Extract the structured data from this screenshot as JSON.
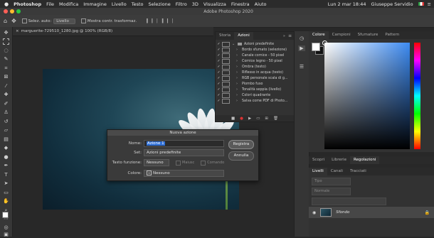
{
  "menubar": {
    "apple": "",
    "items": [
      "Photoshop",
      "File",
      "Modifica",
      "Immagine",
      "Livello",
      "Testo",
      "Selezione",
      "Filtro",
      "3D",
      "Visualizza",
      "Finestra",
      "Aiuto"
    ],
    "clock": "Lun 2 mar 18:44",
    "user": "Giuseppe Servidio"
  },
  "window": {
    "title": "Adobe Photoshop 2020"
  },
  "options": {
    "auto_select_label": "Selez. auto:",
    "auto_select_value": "Livello",
    "transform_label": "Mostra contr. trasformaz."
  },
  "document": {
    "tab": "marguerite-729510_1280.jpg @ 100% (RGB/8)"
  },
  "actions_panel": {
    "tabs": [
      "Storia",
      "Azioni"
    ],
    "active_tab": "Azioni",
    "set_name": "Azioni predefinite",
    "items": [
      "Bordo sfumato (selezione)",
      "Canale cornice - 50 pixel",
      "Cornice legno - 50 pixel",
      "Ombra (testo)",
      "Riflesso in acqua (testo)",
      "RGB personale scala di g...",
      "Piombo fuso",
      "Tonalità seppia (livello)",
      "Colori quadrante",
      "Salva come PDF di Photo..."
    ]
  },
  "color_panel": {
    "tabs": [
      "Colore",
      "Campioni",
      "Sfumature",
      "Pattern"
    ],
    "fg_color": "#ffffff",
    "bg_color": "#111111",
    "field_hue": "#3d8bf2"
  },
  "libraries_tabs": [
    "Scopri",
    "Librerie",
    "Regolazioni"
  ],
  "layers_panel": {
    "tabs": [
      "Livelli",
      "Canali",
      "Tracciati"
    ],
    "filter_placeholder": "Tipo",
    "blend_mode": "Normale",
    "layer_name": "Sfondo"
  },
  "dialog": {
    "title": "Nuova azione",
    "name_label": "Nome:",
    "name_value": "Azione 1",
    "set_label": "Set:",
    "set_value": "Azioni predefinite",
    "fkey_label": "Tasto funzione:",
    "fkey_value": "Nessuno",
    "shift_label": "Maiusc",
    "cmd_label": "Comando",
    "color_label": "Colore:",
    "color_value": "Nessuno",
    "record_button": "Registra",
    "cancel_button": "Annulla"
  },
  "colors": {
    "accent": "#2f6fd6",
    "panel": "#323232"
  }
}
